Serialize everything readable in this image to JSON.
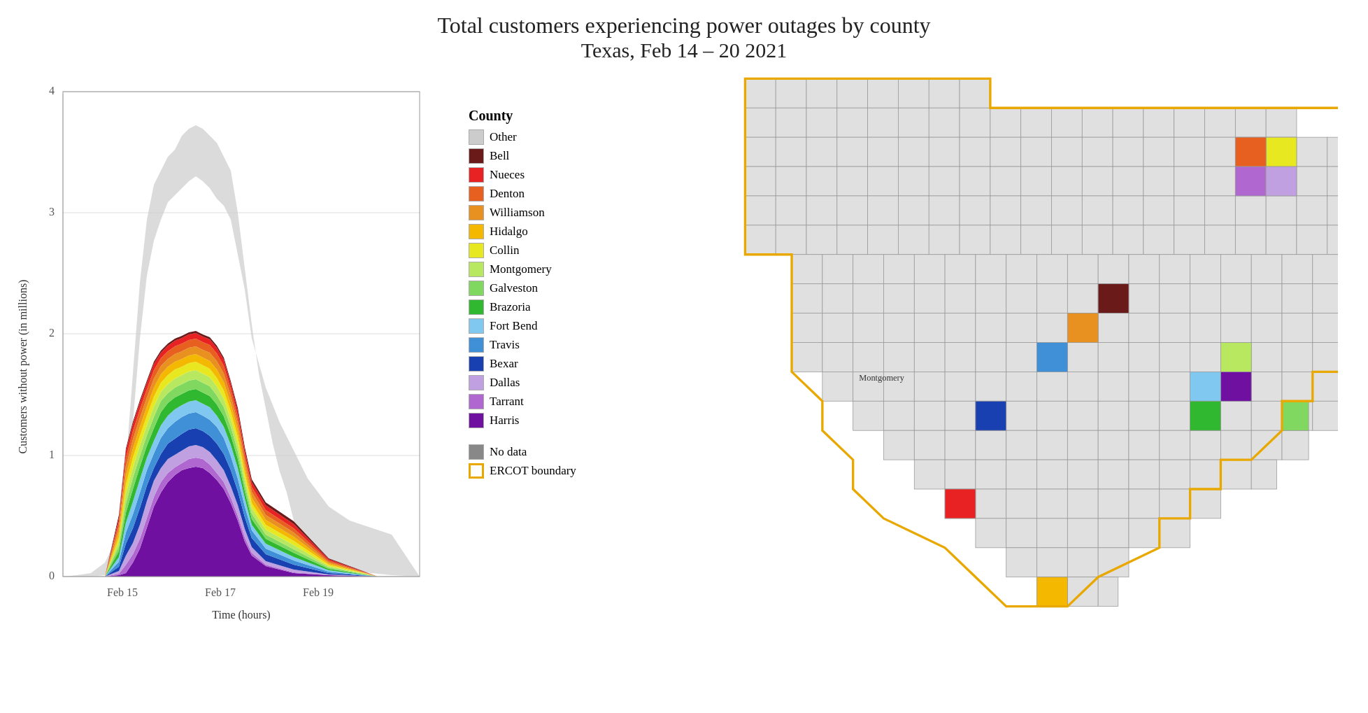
{
  "title": {
    "line1": "Total customers experiencing power outages by county",
    "line2": "Texas, Feb 14 – 20 2021"
  },
  "chart": {
    "yaxis_label": "Customers without power (in millions)",
    "xaxis_label": "Time (hours)",
    "yticks": [
      "0",
      "1",
      "2",
      "3",
      "4"
    ],
    "xticks": [
      "Feb 15",
      "Feb 17",
      "Feb 19"
    ]
  },
  "legend": {
    "title": "County",
    "items": [
      {
        "label": "Other",
        "color": "#cccccc"
      },
      {
        "label": "Bell",
        "color": "#6b1a1a"
      },
      {
        "label": "Nueces",
        "color": "#e82222"
      },
      {
        "label": "Denton",
        "color": "#e86020"
      },
      {
        "label": "Williamson",
        "color": "#e89020"
      },
      {
        "label": "Hidalgo",
        "color": "#f5b800"
      },
      {
        "label": "Collin",
        "color": "#e8e820"
      },
      {
        "label": "Montgomery",
        "color": "#b8e860"
      },
      {
        "label": "Galveston",
        "color": "#80d860"
      },
      {
        "label": "Brazoria",
        "color": "#30b830"
      },
      {
        "label": "Fort Bend",
        "color": "#80c8f0"
      },
      {
        "label": "Travis",
        "color": "#4090d8"
      },
      {
        "label": "Bexar",
        "color": "#1840b0"
      },
      {
        "label": "Dallas",
        "color": "#c0a0e0"
      },
      {
        "label": "Tarrant",
        "color": "#b068d0"
      },
      {
        "label": "Harris",
        "color": "#7010a0"
      }
    ],
    "extra": [
      {
        "label": "No data",
        "color": "#888888"
      },
      {
        "label": "ERCOT boundary",
        "color": "#e8a800"
      }
    ]
  }
}
